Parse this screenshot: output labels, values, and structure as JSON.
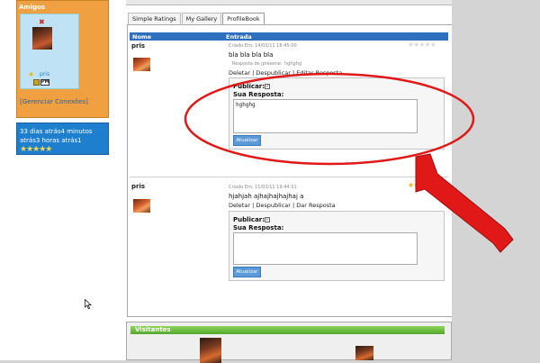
{
  "sidebar": {
    "amigos_title": "Amigos",
    "friend_name": "pris",
    "pm_label": "PM",
    "manage_link": "[Gerenciar Conexões]",
    "time_text": "33 dias atrás4 minutos atrás3 horas atrás1",
    "rating_stars": "★★★★★"
  },
  "tabs": [
    "Simple Ratings",
    "My Gallery",
    "ProfileBook"
  ],
  "columns": {
    "name": "Nome",
    "entry": "Entrada"
  },
  "entries": [
    {
      "author": "pris",
      "date": "Criado Em: 14/03/11 18:45:00",
      "stars": "★★★★★",
      "text": "bla bla bla bla",
      "reply_meta": "Resposta de jprexene:",
      "reply_meta_value": "hghghg",
      "actions": [
        "Deletar",
        "Despublicar",
        "Editar Resposta"
      ],
      "publish_label": "Publicar:",
      "response_label": "Sua Resposta:",
      "response_value": "hghghg",
      "button": "Atualizar"
    },
    {
      "author": "pris",
      "date": "Criado Em: 11/03/11 19:44:31",
      "stars": "★★★★",
      "text": "hjahjah ajhajhajhajhaj a",
      "actions": [
        "Deletar",
        "Despublicar",
        "Dar Resposta"
      ],
      "publish_label": "Publicar:",
      "response_label": "Sua Resposta:",
      "response_value": "",
      "button": "Atualizar"
    }
  ],
  "visitors": {
    "title": "Visitantes"
  },
  "colors": {
    "annotation_red": "#e01818",
    "header_blue": "#2f6fbf",
    "amigos_orange": "#f0a040"
  },
  "icons": [
    "remove-x-icon",
    "star-icon",
    "online-status-icon",
    "pm-icon",
    "mouse-cursor-icon",
    "red-arrow-annotation",
    "red-ellipse-annotation"
  ]
}
